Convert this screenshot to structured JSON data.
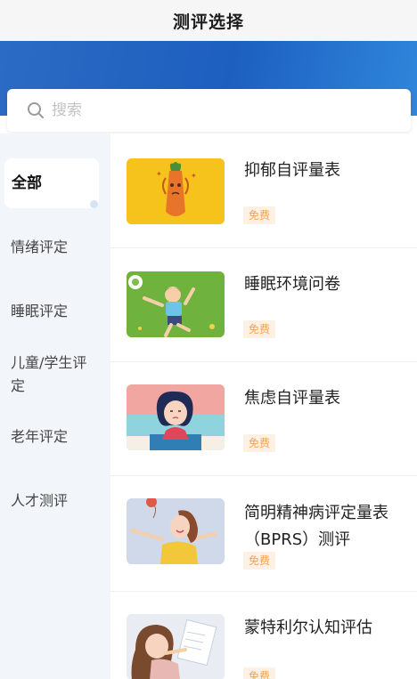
{
  "header": {
    "title": "测评选择"
  },
  "search": {
    "placeholder": "搜索"
  },
  "sidebar": {
    "items": [
      {
        "label": "全部",
        "active": true
      },
      {
        "label": "情绪评定"
      },
      {
        "label": "睡眠评定"
      },
      {
        "label": "儿童/学生评定"
      },
      {
        "label": "老年评定"
      },
      {
        "label": "人才测评"
      }
    ]
  },
  "assessments": [
    {
      "name": "抑郁自评量表",
      "badge": "免费",
      "image": "carrot-character-illustration"
    },
    {
      "name": "睡眠环境问卷",
      "badge": "免费",
      "image": "girl-lying-on-grass-illustration"
    },
    {
      "name": "焦虑自评量表",
      "badge": "免费",
      "image": "anxious-girl-illustration"
    },
    {
      "name": "简明精神病评定量表（BPRS）测评",
      "badge": "免费",
      "image": "girl-with-balloons-illustration"
    },
    {
      "name": "蒙特利尔认知评估",
      "badge": "免费",
      "image": "girl-reading-paper-illustration"
    }
  ],
  "colors": {
    "banner": "#1d5fbf",
    "badge_bg": "#fdf0e4",
    "badge_text": "#f2a35b",
    "sidebar_bg": "#f2f6fb"
  }
}
